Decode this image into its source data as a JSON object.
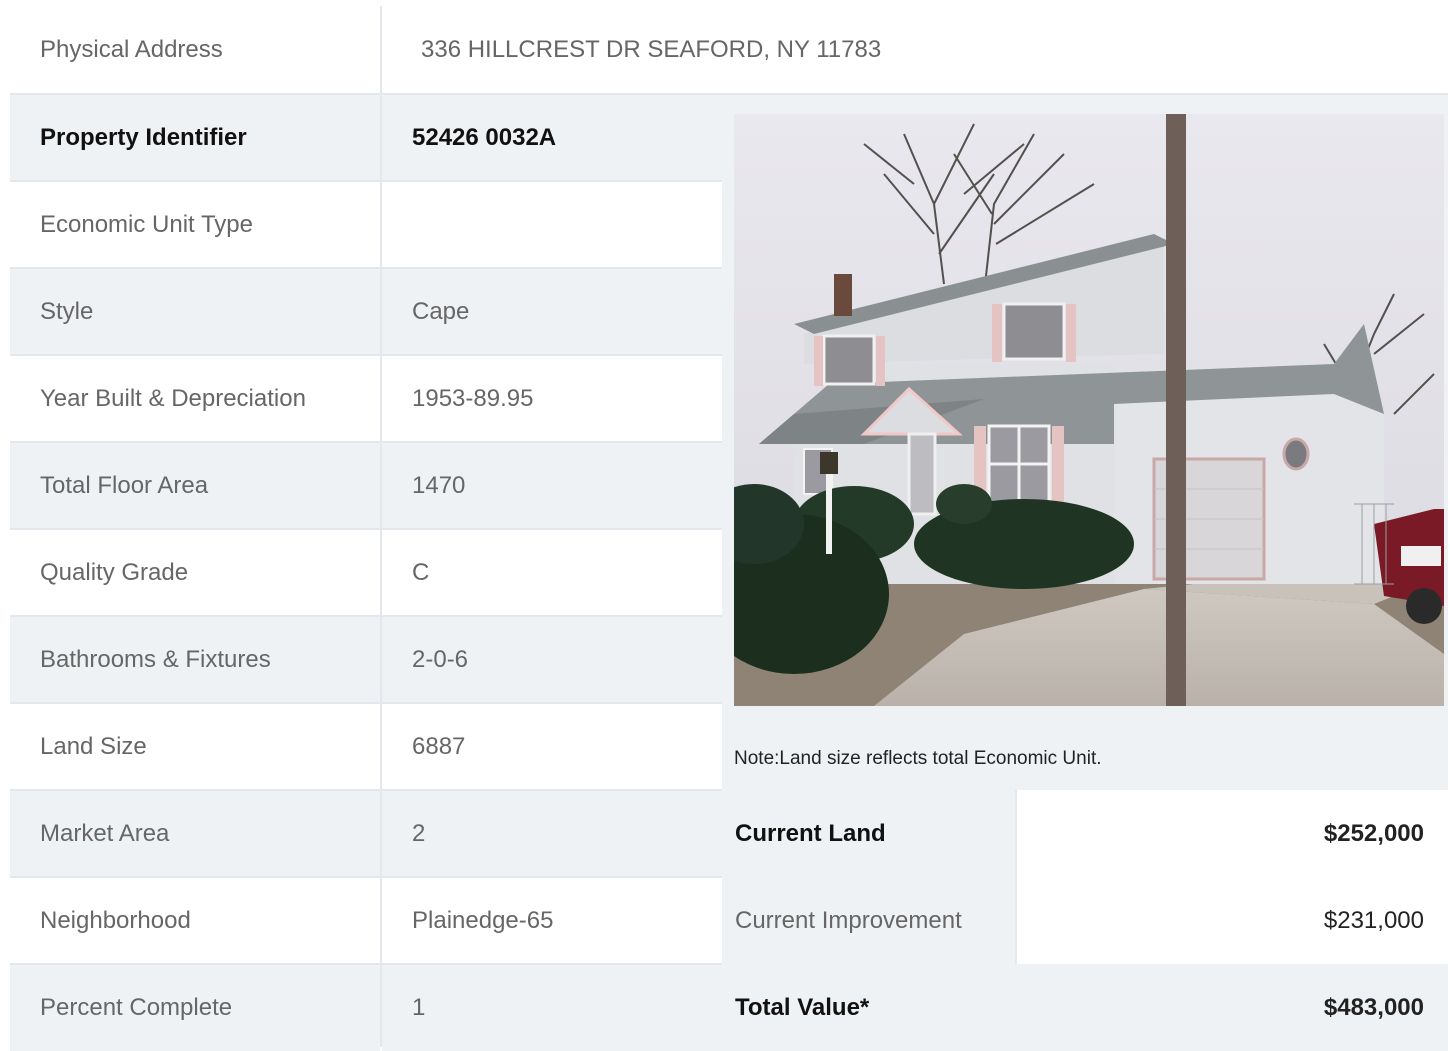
{
  "address": {
    "label": "Physical Address",
    "value": "336  HILLCREST DR  SEAFORD, NY  11783"
  },
  "left_rows": [
    {
      "label": "Property Identifier",
      "value": "52426  0032A"
    },
    {
      "label": "Economic Unit Type",
      "value": ""
    },
    {
      "label": "Style",
      "value": "Cape"
    },
    {
      "label": "Year Built & Depreciation",
      "value": "1953-89.95"
    },
    {
      "label": "Total Floor Area",
      "value": "1470"
    },
    {
      "label": "Quality Grade",
      "value": "C"
    },
    {
      "label": "Bathrooms & Fixtures",
      "value": "2-0-6"
    },
    {
      "label": "Land Size",
      "value": "6887"
    },
    {
      "label": "Market Area",
      "value": "2"
    },
    {
      "label": "Neighborhood",
      "value": "Plainedge-65"
    },
    {
      "label": "Percent Complete",
      "value": "1"
    }
  ],
  "note": "Note:Land size reflects total Economic Unit.",
  "values": [
    {
      "label": "Current Land",
      "value": "$252,000"
    },
    {
      "label": "Current Improvement",
      "value": "$231,000"
    },
    {
      "label": "Total Value*",
      "value": "$483,000"
    }
  ],
  "colors": {
    "row_grey": "#eff2f5",
    "border": "#e4e8ec",
    "text": "#666666"
  }
}
